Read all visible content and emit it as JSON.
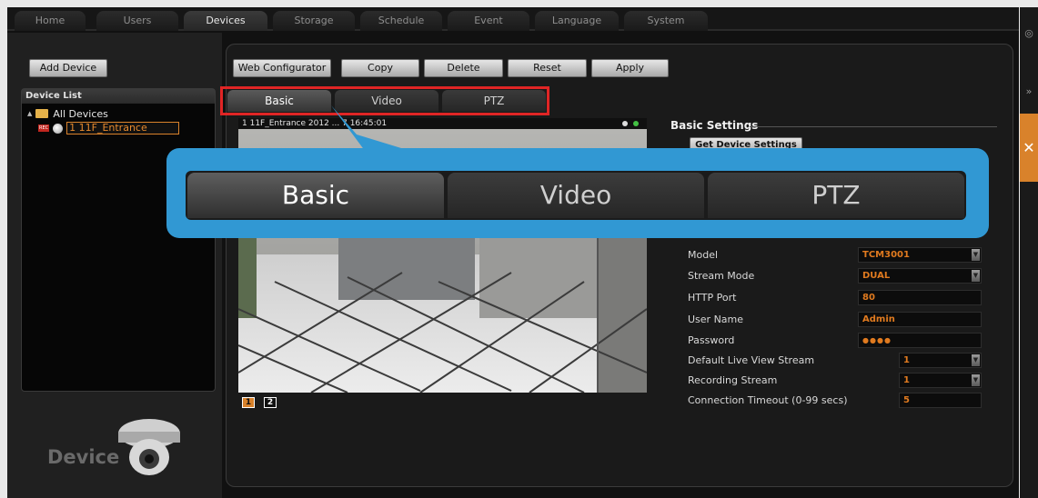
{
  "nav": {
    "tabs": [
      "Home",
      "Users",
      "Devices",
      "Storage",
      "Schedule",
      "Event",
      "Language",
      "System"
    ],
    "active": "Devices"
  },
  "left": {
    "add_device_label": "Add Device",
    "device_list_title": "Device List",
    "tree_root": "All Devices",
    "device_name": "1 11F_Entrance",
    "rec_badge": "REC",
    "footer_label": "Device"
  },
  "toolbar": {
    "web_configurator": "Web Configurator",
    "copy": "Copy",
    "delete": "Delete",
    "reset": "Reset",
    "apply": "Apply"
  },
  "subtabs": [
    "Basic",
    "Video",
    "PTZ"
  ],
  "preview": {
    "overlay_text": "1 11F_Entrance  2012 ... 7 16:45:01",
    "pages": [
      "1",
      "2"
    ]
  },
  "callout": {
    "tabs": [
      "Basic",
      "Video",
      "PTZ"
    ]
  },
  "settings": {
    "section_title": "Basic Settings",
    "get_device_settings": "Get Device Settings",
    "model_label": "Model",
    "model_value": "TCM3001",
    "stream_mode_label": "Stream Mode",
    "stream_mode_value": "DUAL",
    "http_port_label": "HTTP Port",
    "http_port_value": "80",
    "user_name_label": "User Name",
    "user_name_value": "Admin",
    "password_label": "Password",
    "password_value": "●●●●",
    "live_view_label": "Default Live View Stream",
    "live_view_value": "1",
    "recording_label": "Recording Stream",
    "recording_value": "1",
    "timeout_label": "Connection Timeout (0-99 secs)",
    "timeout_value": "5"
  },
  "colors": {
    "accent": "#d9822b",
    "callout": "#3198d3",
    "highlight": "#e02525"
  }
}
